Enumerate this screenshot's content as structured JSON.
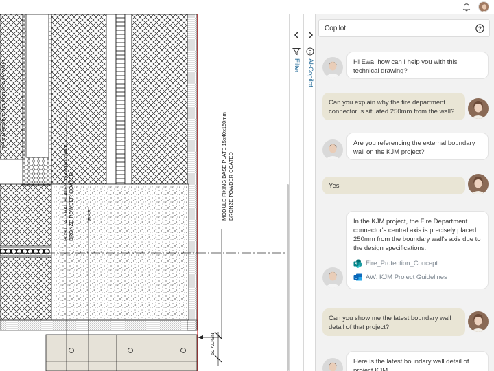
{
  "topbar": {
    "bell_icon": "bell-icon",
    "avatar": "user-avatar"
  },
  "drawing": {
    "labels": {
      "resin_bound": "RESIN BOUND TO BOUNDARY WALL",
      "post_lateral": "POST LATERAL PLATES 15x280x175mm",
      "bronze_1": "BRONZE POWDER COATED",
      "rhs": "RHS",
      "module_fixing": "MODULE FIXING BASE PLATE 15x40x150mm",
      "bronze_2": "BRONZE POWDER COATED",
      "align": "50 ALIGN"
    }
  },
  "rails": {
    "filter_label": "Filter",
    "copilot_label": "AI-Copilot"
  },
  "chat": {
    "title": "Copilot",
    "messages": [
      {
        "role": "ai",
        "text": "Hi Ewa, how can I help you with this technical drawing?"
      },
      {
        "role": "user",
        "text": "Can you explain why the fire department connector is situated 250mm from the wall?"
      },
      {
        "role": "ai",
        "text": "Are you referencing the external boundary wall on the KJM project?"
      },
      {
        "role": "user",
        "text": "Yes"
      },
      {
        "role": "ai",
        "text": "In the KJM project, the Fire Department connector's central axis is precisely placed 250mm from the boundary wall's axis due to the design specifications.",
        "documents": [
          {
            "icon": "sharepoint-icon",
            "label": "Fire_Protection_Concept"
          },
          {
            "icon": "outlook-icon",
            "label": "AW: KJM Project Guidelines"
          }
        ]
      },
      {
        "role": "user",
        "text": "Can you show me the latest boundary wall detail of that project?"
      },
      {
        "role": "ai",
        "text": "Here is the latest boundary wall detail of project KJM"
      }
    ]
  },
  "colors": {
    "accent": "#2a6f9b",
    "user_bubble": "#e9e5d5",
    "panel_bg": "#f2f2f2",
    "red_line": "#cc2222"
  }
}
